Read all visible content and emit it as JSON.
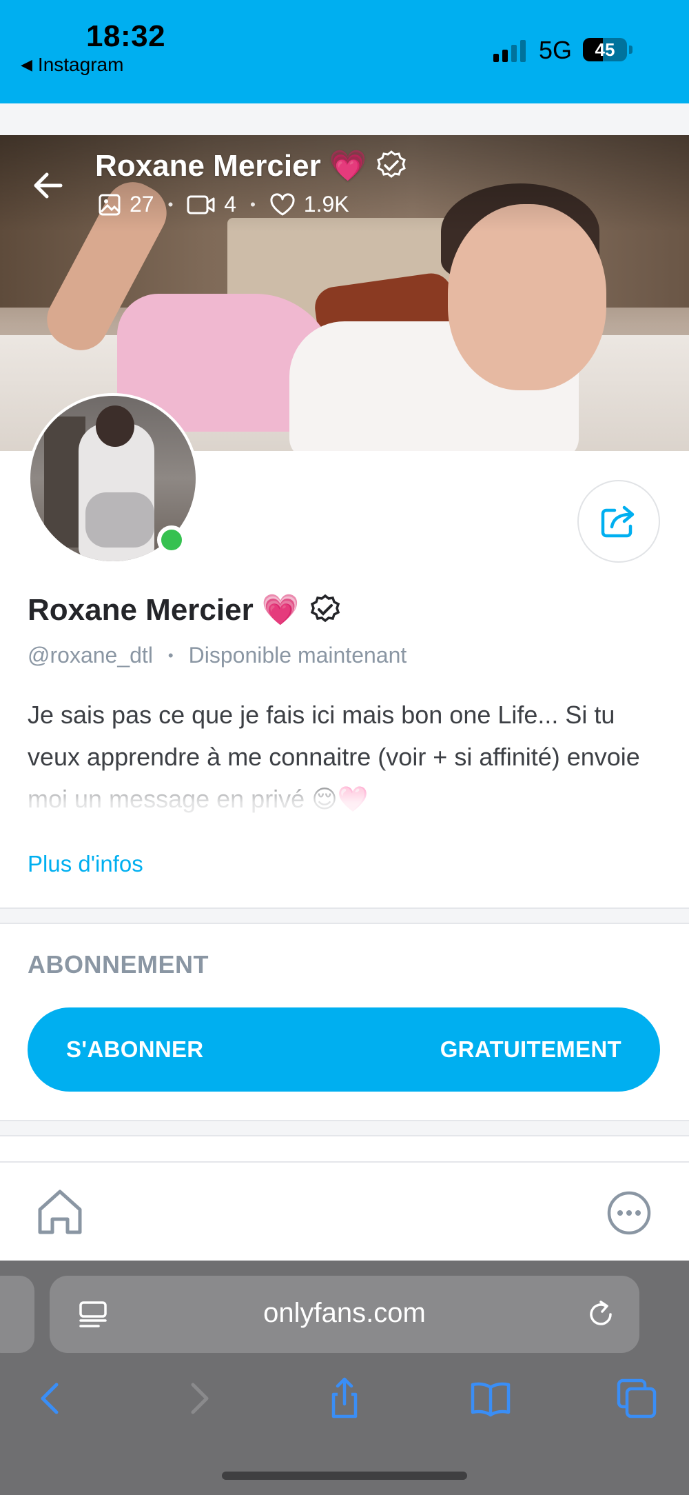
{
  "status_bar": {
    "time": "18:32",
    "back_app": "Instagram",
    "network": "5G",
    "battery_level": "45"
  },
  "colors": {
    "brand": "#00aff0",
    "online": "#36c150",
    "muted": "#8a96a3"
  },
  "profile": {
    "cover_name": "Roxane Mercier 💗",
    "stats": {
      "photos": "27",
      "videos": "4",
      "likes": "1.9K"
    },
    "name": "Roxane Mercier 💗",
    "handle": "@roxane_dtl",
    "separator": "•",
    "availability": "Disponible maintenant",
    "bio": "Je sais pas ce que je fais ici mais bon one Life... Si tu veux apprendre à me connaitre (voir + si affinité) envoie moi un message en privé 😌🩷",
    "more_info": "Plus d'infos",
    "online": true
  },
  "subscription": {
    "title": "ABONNEMENT",
    "button_left": "S'ABONNER",
    "button_right": "GRATUITEMENT"
  },
  "bottom_nav": {
    "icons": [
      "home-icon",
      "more-icon"
    ]
  },
  "browser": {
    "url": "onlyfans.com",
    "icons": [
      "reader-icon",
      "reload-icon",
      "back-icon",
      "forward-icon",
      "share-icon",
      "bookmarks-icon",
      "tabs-icon"
    ]
  }
}
